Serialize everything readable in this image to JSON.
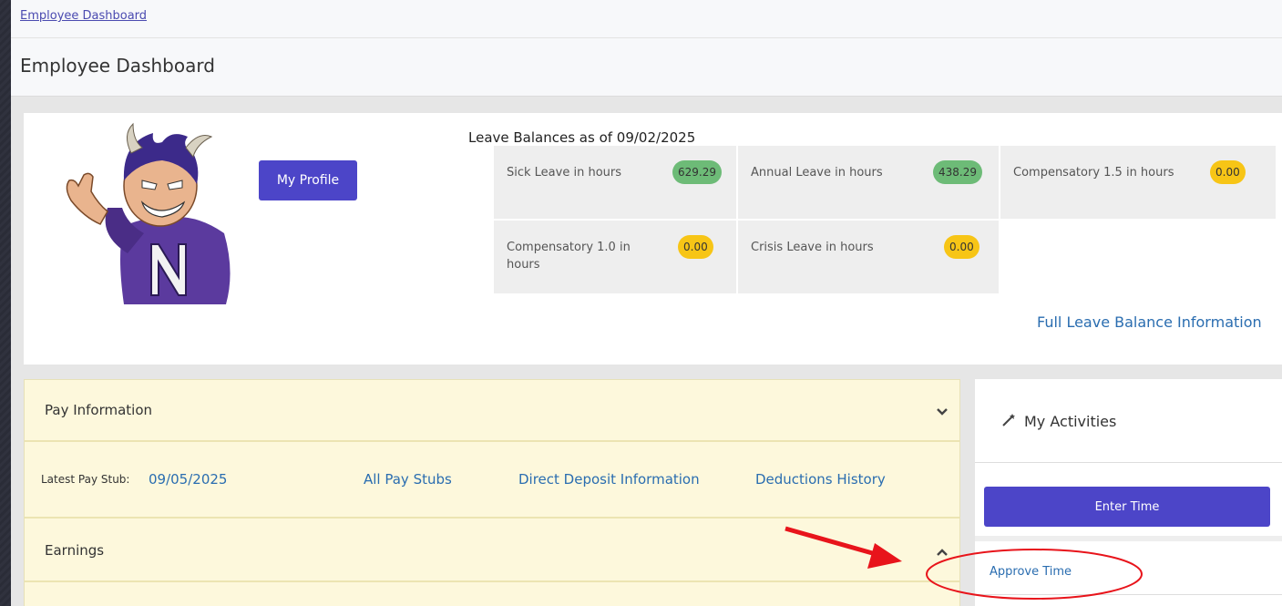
{
  "breadcrumb": {
    "label": "Employee Dashboard"
  },
  "page": {
    "title": "Employee Dashboard"
  },
  "profile": {
    "button_label": "My Profile"
  },
  "leave": {
    "title": "Leave Balances as of 09/02/2025",
    "items": [
      {
        "label": "Sick Leave in hours",
        "value": "629.29",
        "status": "green"
      },
      {
        "label": "Annual Leave in hours",
        "value": "438.29",
        "status": "green"
      },
      {
        "label": "Compensatory 1.5 in hours",
        "value": "0.00",
        "status": "yellow"
      },
      {
        "label": "Compensatory 1.0 in hours",
        "value": "0.00",
        "status": "yellow"
      },
      {
        "label": "Crisis Leave in hours",
        "value": "0.00",
        "status": "yellow"
      }
    ],
    "full_link": "Full Leave Balance Information"
  },
  "pay": {
    "heading": "Pay Information",
    "latest_stub_label": "Latest Pay Stub:",
    "latest_stub_date": "09/05/2025",
    "links": [
      "All Pay Stubs",
      "Direct Deposit Information",
      "Deductions History"
    ],
    "earnings_heading": "Earnings"
  },
  "activities": {
    "title": "My Activities",
    "enter_time": "Enter Time",
    "approve_time": "Approve Time"
  },
  "colors": {
    "primary_button": "#4c45c8",
    "link": "#2a6db0",
    "pill_green": "#6dbb77",
    "pill_yellow": "#f7c516",
    "annotation_red": "#e8141b"
  }
}
